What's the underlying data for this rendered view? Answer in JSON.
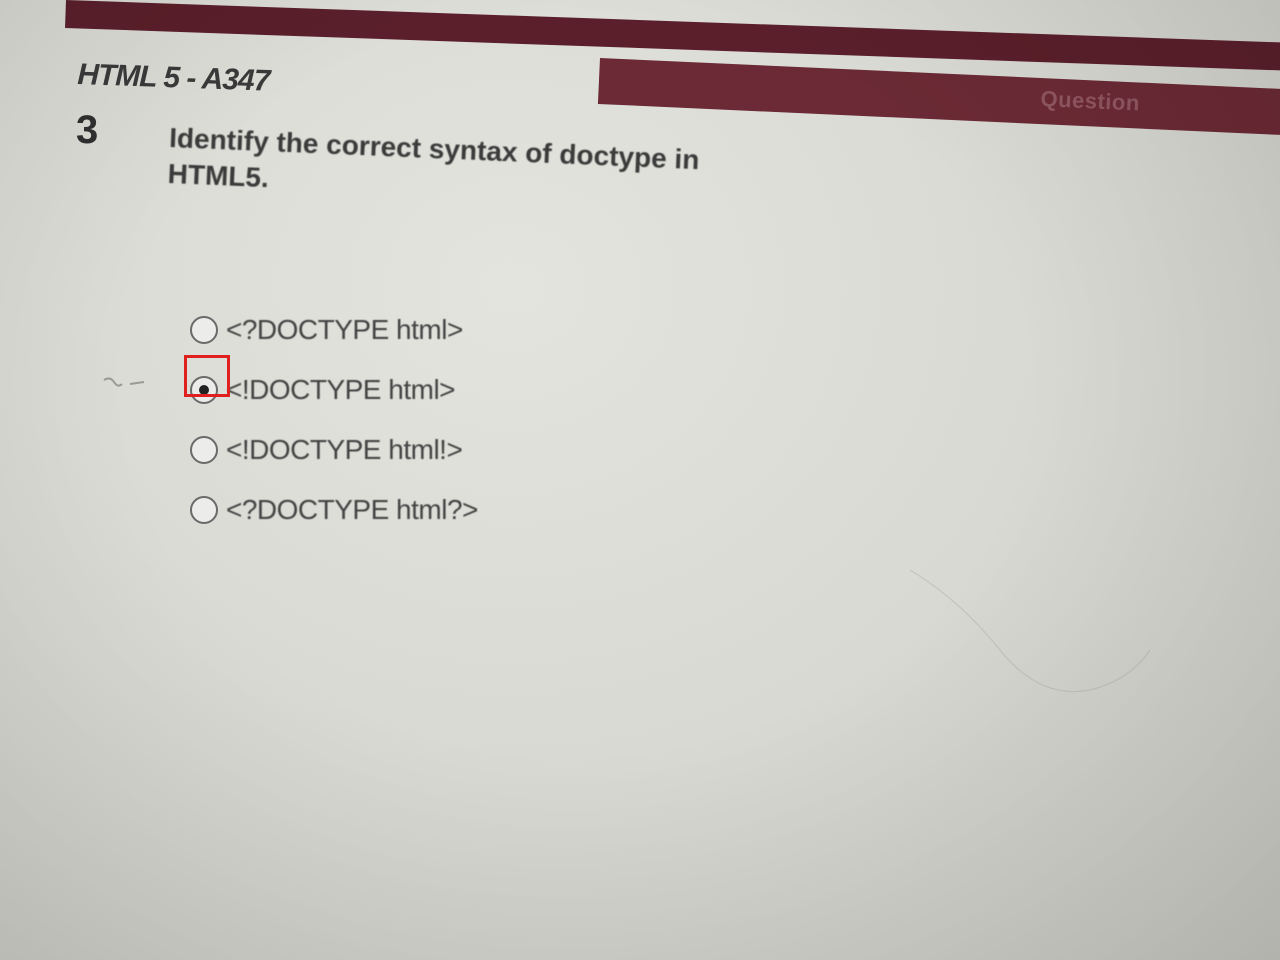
{
  "header": {
    "exam_title": "HTML 5 - A347",
    "bar_label": "Question",
    "accent_color": "#6b2a35"
  },
  "question": {
    "number": "3",
    "text": "Identify the correct syntax of doctype in HTML5."
  },
  "options": [
    {
      "label": "<?DOCTYPE html>",
      "selected": false
    },
    {
      "label": "<!DOCTYPE html>",
      "selected": true
    },
    {
      "label": "<!DOCTYPE html!>",
      "selected": false
    },
    {
      "label": "<?DOCTYPE html?>",
      "selected": false
    }
  ],
  "highlight_color": "#e0201f"
}
